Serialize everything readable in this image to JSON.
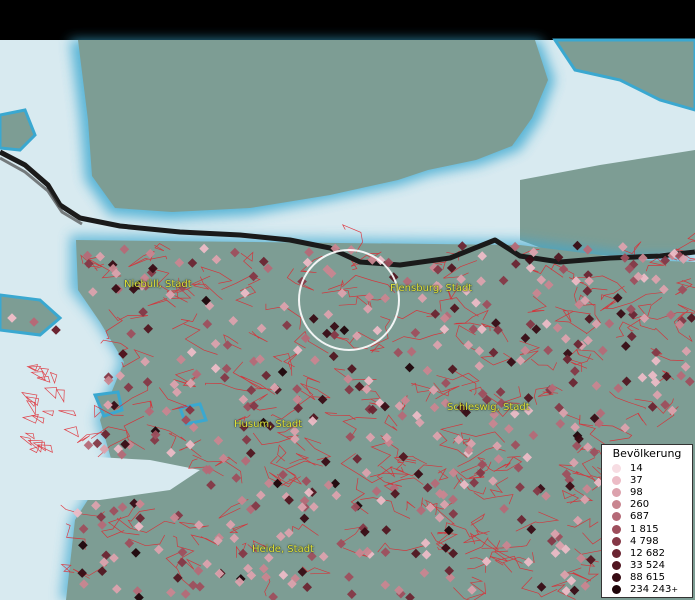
{
  "map": {
    "places": [
      {
        "id": "niebuell",
        "label": "Niebüll, Stadt"
      },
      {
        "id": "flensburg",
        "label": "Flensburg, Stadt"
      },
      {
        "id": "schleswig",
        "label": "Schleswig, Stadt"
      },
      {
        "id": "husum",
        "label": "Husum, Stadt"
      },
      {
        "id": "heide",
        "label": "Heide, Stadt"
      }
    ],
    "colors": {
      "sea": "#d8eaf0",
      "land": "#7d9d94",
      "coast_halo": "#3aa8d0",
      "border": "#1a1a1a",
      "boundaries": "#e0262e",
      "label": "#e0e23a"
    }
  },
  "legend": {
    "title": "Bevölkerung",
    "items": [
      {
        "label": "14",
        "color": "#f7dde3"
      },
      {
        "label": "37",
        "color": "#ecbcc6"
      },
      {
        "label": "98",
        "color": "#dca2ad"
      },
      {
        "label": "260",
        "color": "#c98690"
      },
      {
        "label": "687",
        "color": "#b56a77"
      },
      {
        "label": "1 815",
        "color": "#9e4f5d"
      },
      {
        "label": "4 798",
        "color": "#853846"
      },
      {
        "label": "12 682",
        "color": "#6b2532"
      },
      {
        "label": "33 524",
        "color": "#511620"
      },
      {
        "label": "88 615",
        "color": "#380c14"
      },
      {
        "label": "234 243",
        "color": "#1f0509",
        "suffix": "+"
      }
    ]
  }
}
